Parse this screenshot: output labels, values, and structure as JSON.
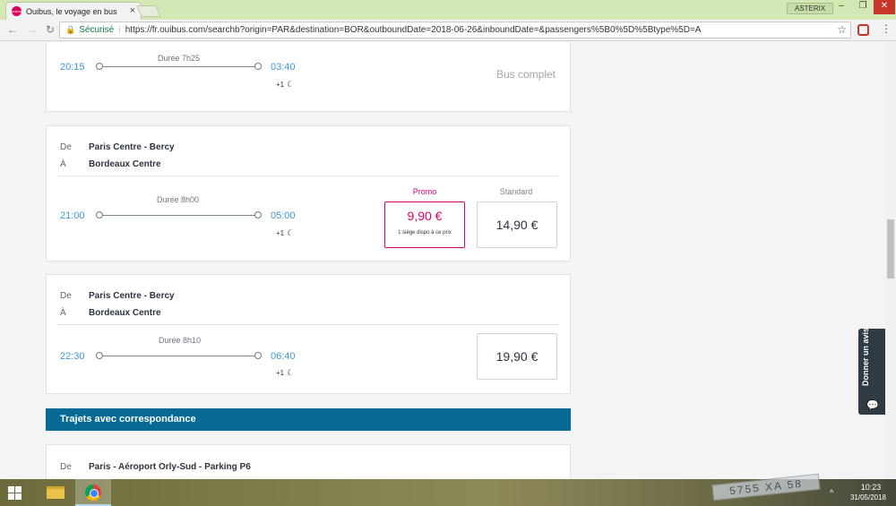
{
  "browser": {
    "tab_title": "Ouibus, le voyage en bus",
    "tab_favicon_text": "ouibus",
    "profile": "ASTERIX",
    "secure_label": "Sécurisé",
    "url": "https://fr.ouibus.com/searchb?origin=PAR&destination=BOR&outboundDate=2018-06-26&inboundDate=&passengers%5B0%5D%5Btype%5D=A",
    "icons": [
      "back-icon",
      "forward-icon",
      "reload-icon",
      "lock-icon",
      "star-icon",
      "extension-icon",
      "menu-icon"
    ]
  },
  "labels": {
    "from": "De",
    "to": "À",
    "plus_one": "+1",
    "promo": "Promo",
    "standard": "Standard"
  },
  "trips": [
    {
      "departure": "20:15",
      "arrival": "03:40",
      "duration": "Durée 7h25",
      "status": "Bus complet"
    },
    {
      "from": "Paris Centre - Bercy",
      "to": "Bordeaux Centre",
      "departure": "21:00",
      "arrival": "05:00",
      "duration": "Durée 8h00",
      "promo_price": "9,90 €",
      "promo_note": "1 siège dispo à ce prix",
      "standard_price": "14,90 €"
    },
    {
      "from": "Paris Centre - Bercy",
      "to": "Bordeaux Centre",
      "departure": "22:30",
      "arrival": "06:40",
      "duration": "Durée 8h10",
      "standard_price": "19,90 €"
    },
    {
      "from": "Paris - Aéroport Orly-Sud - Parking P6"
    }
  ],
  "section_title": "Trajets avec correspondance",
  "feedback_label": "Donner un avis",
  "taskbar": {
    "apps": [
      "start-icon",
      "file-explorer-icon",
      "chrome-icon"
    ],
    "plate_text": "5755 XA 58",
    "time": "10:23",
    "date": "31/05/2018"
  },
  "colors": {
    "accent_blue": "#3a9ad9",
    "promo_pink": "#e0006c",
    "section_header": "#066a95",
    "tab_bar": "#d3e8b2"
  }
}
